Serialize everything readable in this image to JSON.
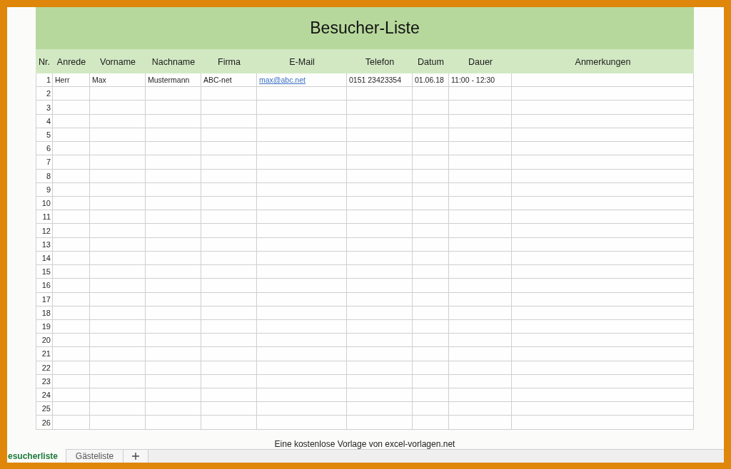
{
  "title": "Besucher-Liste",
  "columns": [
    {
      "label": "Nr.",
      "kind": "index"
    },
    {
      "label": "Anrede",
      "kind": "text"
    },
    {
      "label": "Vorname",
      "kind": "text"
    },
    {
      "label": "Nachname",
      "kind": "text"
    },
    {
      "label": "Firma",
      "kind": "text"
    },
    {
      "label": "E-Mail",
      "kind": "link"
    },
    {
      "label": "Telefon",
      "kind": "text"
    },
    {
      "label": "Datum",
      "kind": "text"
    },
    {
      "label": "Dauer",
      "kind": "text"
    },
    {
      "label": "Anmerkungen",
      "kind": "text"
    }
  ],
  "rows": [
    {
      "cells": [
        "1",
        "Herr",
        "Max",
        "Mustermann",
        "ABC-net",
        "max@abc.net",
        "0151 23423354",
        "01.06.18",
        "11:00 - 12:30"
      ]
    },
    {
      "cells": [
        "2"
      ]
    },
    {
      "cells": [
        "3"
      ]
    },
    {
      "cells": [
        "4"
      ]
    },
    {
      "cells": [
        "5"
      ]
    },
    {
      "cells": [
        "6"
      ]
    },
    {
      "cells": [
        "7"
      ]
    },
    {
      "cells": [
        "8"
      ]
    },
    {
      "cells": [
        "9"
      ]
    },
    {
      "cells": [
        "10"
      ]
    },
    {
      "cells": [
        "11"
      ]
    },
    {
      "cells": [
        "12"
      ]
    },
    {
      "cells": [
        "13"
      ]
    },
    {
      "cells": [
        "14"
      ]
    },
    {
      "cells": [
        "15"
      ]
    },
    {
      "cells": [
        "16"
      ]
    },
    {
      "cells": [
        "17"
      ]
    },
    {
      "cells": [
        "18"
      ]
    },
    {
      "cells": [
        "19"
      ]
    },
    {
      "cells": [
        "20"
      ]
    },
    {
      "cells": [
        "21"
      ]
    },
    {
      "cells": [
        "22"
      ]
    },
    {
      "cells": [
        "23"
      ]
    },
    {
      "cells": [
        "24"
      ]
    },
    {
      "cells": [
        "25"
      ]
    },
    {
      "cells": [
        "26"
      ]
    }
  ],
  "footer_note": "Eine kostenlose Vorlage von excel-vorlagen.net",
  "sheet_tabs": [
    {
      "label": "esucherliste",
      "selected": true
    },
    {
      "label": "Gästeliste",
      "selected": false
    }
  ]
}
